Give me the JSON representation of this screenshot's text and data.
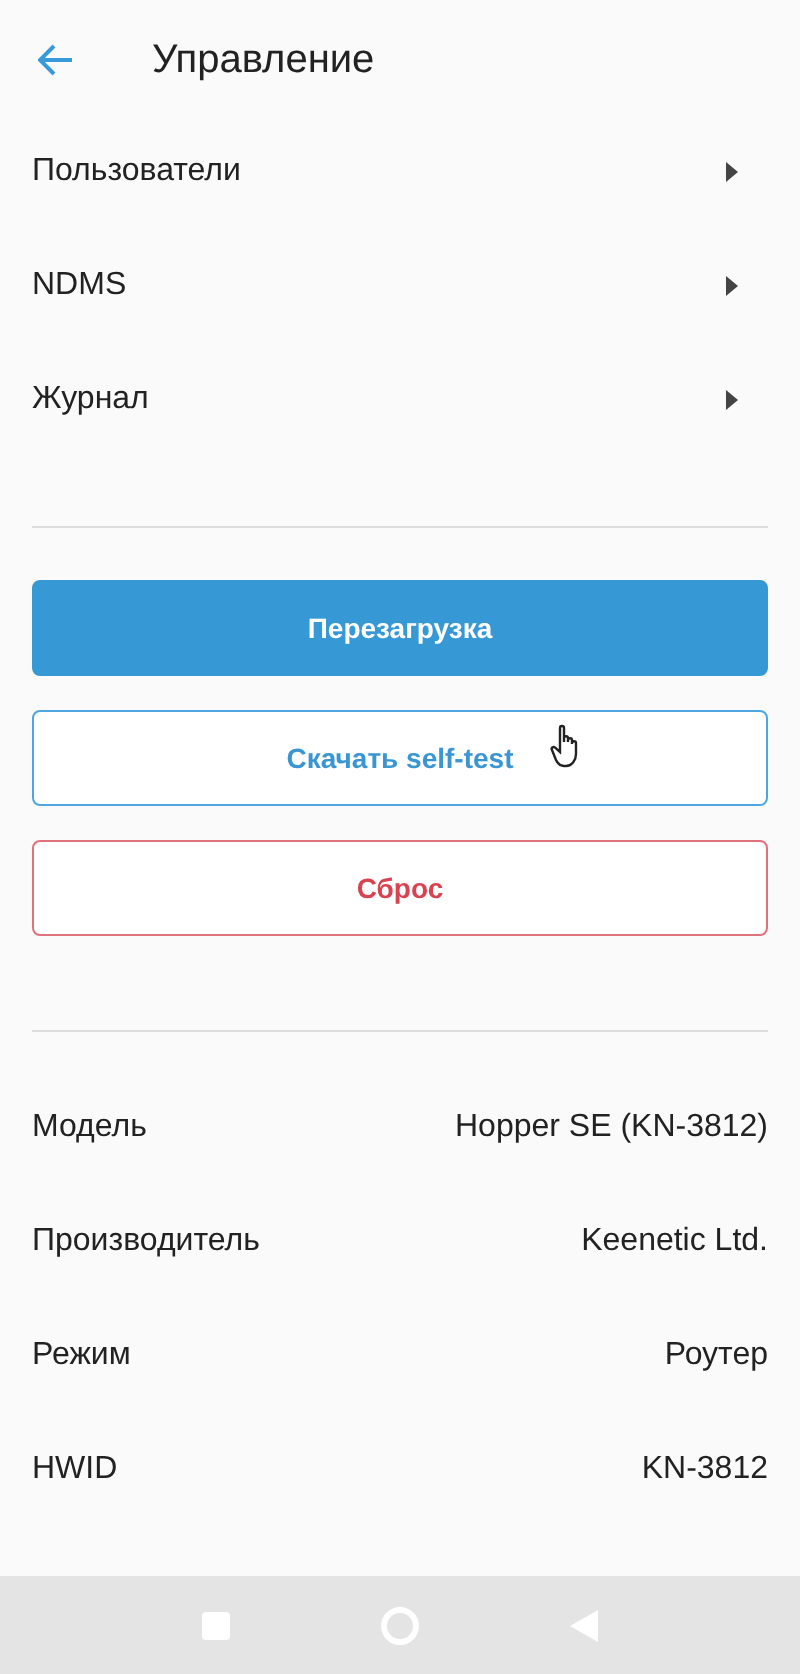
{
  "header": {
    "title": "Управление"
  },
  "menu": [
    {
      "label": "Пользователи"
    },
    {
      "label": "NDMS"
    },
    {
      "label": "Журнал"
    }
  ],
  "buttons": [
    {
      "label": "Перезагрузка",
      "kind": "primary"
    },
    {
      "label": "Скачать self-test",
      "kind": "outline"
    },
    {
      "label": "Сброс",
      "kind": "danger"
    }
  ],
  "info": [
    {
      "label": "Модель",
      "value": "Hopper SE (KN-3812)"
    },
    {
      "label": "Производитель",
      "value": "Keenetic Ltd."
    },
    {
      "label": "Режим",
      "value": "Роутер"
    },
    {
      "label": "HWID",
      "value": "KN-3812"
    }
  ]
}
